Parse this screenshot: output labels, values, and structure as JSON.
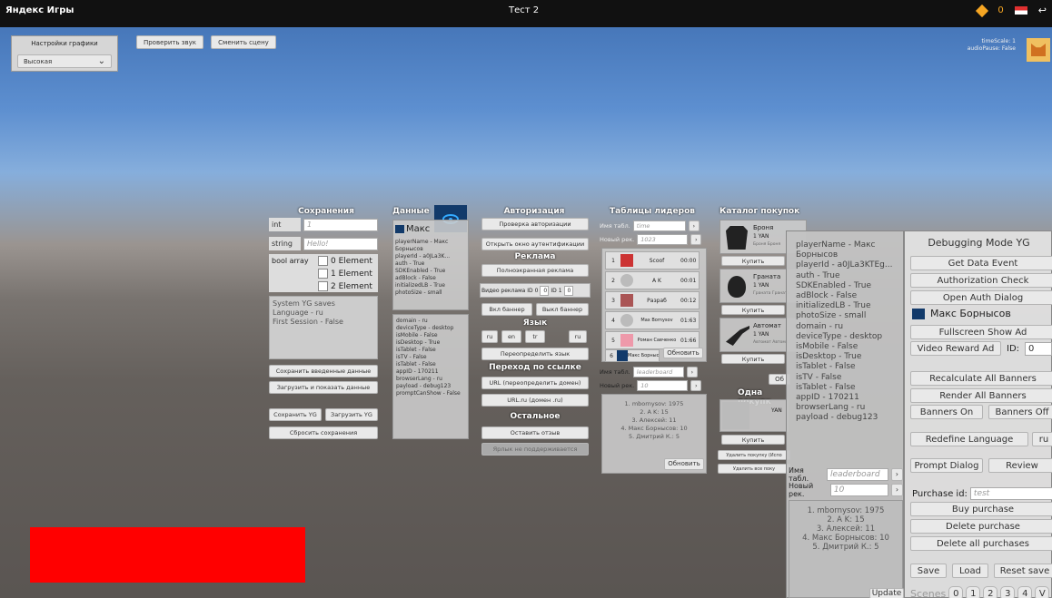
{
  "titlebar": {
    "app": "Яндекс Игры",
    "game": "Тест 2",
    "coins": "0"
  },
  "top": {
    "graphics_label": "Настройки графики",
    "graphics_value": "Высокая",
    "check_sound": "Проверить звук",
    "change_scene": "Сменить сцену",
    "time_scale": "timeScale: 1",
    "audio_pause": "audioPause: False"
  },
  "saves": {
    "title": "Сохранения",
    "int_label": "int",
    "int_value": "1",
    "string_label": "string",
    "string_value": "Hello!",
    "bool_label": "bool array",
    "elements": [
      "0 Element",
      "1 Element",
      "2 Element"
    ],
    "system_title": "System YG saves",
    "language": "Language - ru",
    "first_session": "First Session - False",
    "save_entered": "Сохранить введенные данные",
    "load_show": "Загрузить и показать данные",
    "save_yg": "Сохранить YG",
    "load_yg": "Загрузить YG",
    "reset": "Сбросить сохранения"
  },
  "data": {
    "title": "Данные",
    "player_short": "Макс",
    "info1": [
      "playerName - Макс",
      "Борнысов",
      "playerId - a0JLa3K...",
      "auth - True",
      "SDKEnabled - True",
      "adBlock - False",
      "initializedLB - True",
      "photoSize - small"
    ],
    "info2": [
      "domain - ru",
      "deviceType - desktop",
      "isMobile - False",
      "isDesktop - True",
      "isTablet - False",
      "isTV - False",
      "isTablet - False",
      "appID - 170211",
      "browserLang - ru",
      "payload - debug123",
      "promptCanShow - False"
    ]
  },
  "auth": {
    "title": "Авторизация",
    "check": "Проверка авторизации",
    "open": "Открыть окно аутентификации",
    "ads_title": "Реклама",
    "fullscreen": "Полноэкранная реклама",
    "video": "Видео реклама",
    "video_vals": [
      "ID 0",
      "0",
      "ID 1",
      "0"
    ],
    "banner_on": "Вкл баннер",
    "banner_off": "Выкл баннер",
    "lang_title": "Язык",
    "langs": [
      "ru",
      "en",
      "tr",
      "ru"
    ],
    "redefine": "Переопределить язык",
    "link_title": "Переход по ссылке",
    "url_redefine": "URL (переопределить домен)",
    "url_ru": "URL.ru (домен .ru)",
    "other_title": "Остальное",
    "review": "Оставить отзыв",
    "shortcut": "Ярлык не поддерживается"
  },
  "leaders": {
    "title": "Таблицы лидеров",
    "name_label": "Имя табл.",
    "name_value": "time",
    "rec_label": "Новый рек.",
    "rec_value": "1023",
    "rows": [
      {
        "n": "1",
        "name": "Scoof",
        "score": "00:00"
      },
      {
        "n": "2",
        "name": "A K",
        "score": "00:01"
      },
      {
        "n": "3",
        "name": "Разраб",
        "score": "00:12"
      },
      {
        "n": "4",
        "name": "Max Bornysov",
        "score": "01:63"
      },
      {
        "n": "5",
        "name": "Роман Савченко",
        "score": "01:66"
      },
      {
        "n": "6",
        "name": "Макс Борнысов",
        "score": ""
      }
    ],
    "update": "Обновить",
    "name2_value": "leaderboard",
    "rec2_value": "10",
    "list": [
      "1. mbornysov: 1975",
      "2. A K: 15",
      "3. Алексей: 11",
      "4. Макс Борнысов: 10",
      "5. Дмитрий К.: 5"
    ],
    "update2": "Обновить"
  },
  "catalog": {
    "title": "Каталог покупок",
    "items": [
      {
        "name": "Броня",
        "price": "1 YAN",
        "desc": "Броня Броня"
      },
      {
        "name": "Граната",
        "price": "1 YAN",
        "desc": "Граната Граната"
      },
      {
        "name": "Автомат",
        "price": "1 YAN",
        "desc": "Автомат Автомат"
      }
    ],
    "buy": "Купить",
    "ob": "Об",
    "one_title": "Одна покупк",
    "one_price": "YAN",
    "delete": "Удалить покупку (Испо",
    "delete_all": "Удалить все поку"
  },
  "info_panel": {
    "lines": [
      "playerName - Макс",
      "Борнысов",
      "playerId - a0JLa3KTEg...",
      "auth - True",
      "SDKEnabled - True",
      "adBlock - False",
      "initializedLB - True",
      "photoSize - small",
      "domain - ru",
      "deviceType - desktop",
      "isMobile - False",
      "isDesktop - True",
      "isTablet - False",
      "isTV - False",
      "isTablet - False",
      "appID - 170211",
      "browserLang - ru",
      "payload - debug123"
    ],
    "name_label": "Имя табл.",
    "name_value": "leaderboard",
    "rec_label": "Новый рек.",
    "rec_value": "10",
    "list": [
      "1. mbornysov: 1975",
      "2. A K: 15",
      "3. Алексей: 11",
      "4. Макс Борнысов: 10",
      "5. Дмитрий К.: 5"
    ],
    "update": "Update"
  },
  "debug": {
    "title": "Debugging Mode YG",
    "get_data": "Get Data Event",
    "auth_check": "Authorization Check",
    "open_auth": "Open Auth Dialog",
    "player": "Макс Борнысов",
    "fullscreen": "Fullscreen Show Ad",
    "video": "Video Reward Ad",
    "id_label": "ID:",
    "id_value": "0",
    "recalc": "Recalculate All Banners",
    "render": "Render All Banners",
    "banners_on": "Banners On",
    "banners_off": "Banners Off",
    "redefine": "Redefine Language",
    "lang": "ru",
    "prompt": "Prompt Dialog",
    "review": "Review",
    "purchase_label": "Purchase",
    "purchase_id_label": "id:",
    "purchase_value": "test",
    "buy": "Buy purchase",
    "delete": "Delete purchase",
    "delete_all": "Delete all purchases",
    "save": "Save",
    "load": "Load",
    "reset": "Reset save",
    "scenes_label": "Scenes",
    "scenes": [
      "0",
      "1",
      "2",
      "3",
      "4"
    ],
    "last": "V"
  },
  "colors": {
    "banner": "#ff0000",
    "coin": "#f6a623"
  }
}
